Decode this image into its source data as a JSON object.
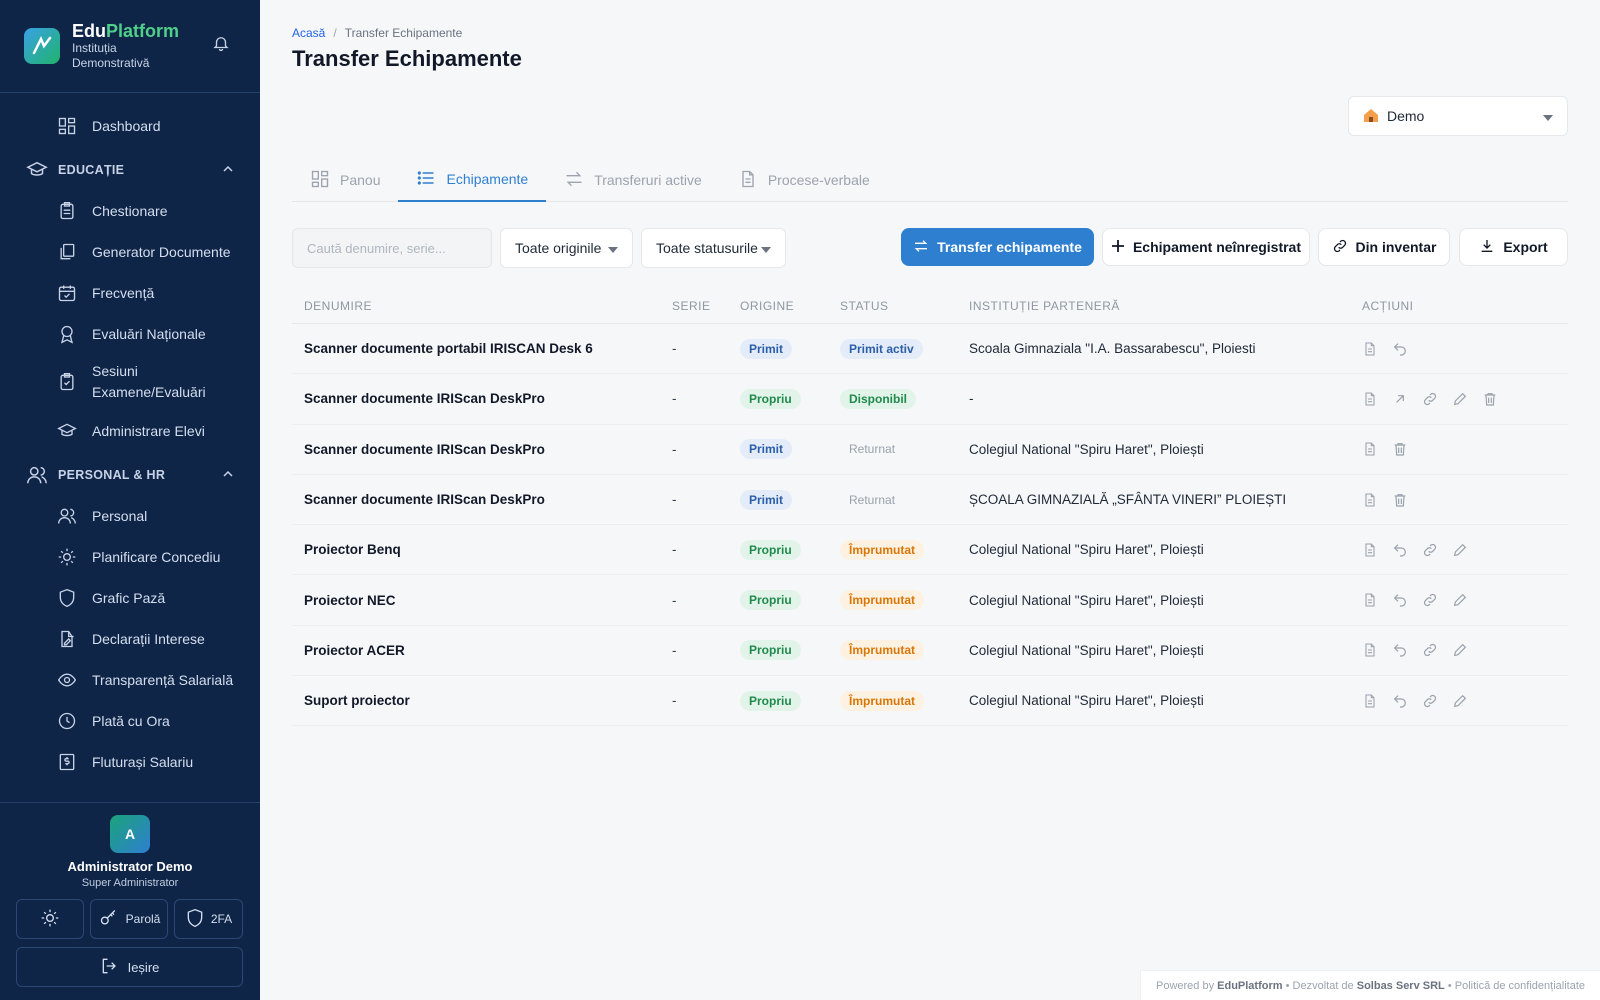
{
  "brand": {
    "name_a": "Edu",
    "name_b": "Platform",
    "subtitle": "Instituția Demonstrativă"
  },
  "nav": {
    "dashboard": "Dashboard",
    "section_education": "EDUCAȚIE",
    "chestionare": "Chestionare",
    "generator": "Generator Documente",
    "frecventa": "Frecvență",
    "evaluari": "Evaluări Naționale",
    "sesiuni_1": "Sesiuni",
    "sesiuni_2": "Examene/Evaluări",
    "elevi": "Administrare Elevi",
    "section_hr": "PERSONAL & HR",
    "personal": "Personal",
    "concediu": "Planificare Concediu",
    "paza": "Grafic Pază",
    "declaratii": "Declarații Interese",
    "transparenta": "Transparență Salarială",
    "plata": "Plată cu Ora",
    "fluturasi": "Fluturași Salariu"
  },
  "user": {
    "initial": "A",
    "name": "Administrator Demo",
    "role": "Super Administrator",
    "password_label": "Parolă",
    "twofa_label": "2FA",
    "logout_label": "Ieșire"
  },
  "breadcrumb": {
    "home": "Acasă",
    "sep": "/",
    "current": "Transfer Echipamente"
  },
  "page": {
    "title": "Transfer Echipamente"
  },
  "institution": {
    "selected": "Demo"
  },
  "tabs": {
    "panou": "Panou",
    "echipamente": "Echipamente",
    "transferuri": "Transferuri active",
    "procese": "Procese-verbale"
  },
  "toolbar": {
    "search_placeholder": "Caută denumire, serie...",
    "origin_filter": "Toate originile",
    "status_filter": "Toate statusurile",
    "transfer_btn": "Transfer echipamente",
    "unregistered_btn": "Echipament neînregistrat",
    "inventory_btn": "Din inventar",
    "export_btn": "Export"
  },
  "table": {
    "headers": {
      "name": "DENUMIRE",
      "serial": "SERIE",
      "origin": "ORIGINE",
      "status": "STATUS",
      "partner": "INSTITUȚIE PARTENERĂ",
      "actions": "ACȚIUNI"
    },
    "rows": [
      {
        "name": "Scanner documente portabil IRISCAN Desk 6",
        "serial": "-",
        "origin": "Primit",
        "status": "Primit activ",
        "partner": "Scoala Gimnaziala \"I.A. Bassarabescu\", Ploiesti"
      },
      {
        "name": "Scanner documente IRIScan DeskPro",
        "serial": "-",
        "origin": "Propriu",
        "status": "Disponibil",
        "partner": "-"
      },
      {
        "name": "Scanner documente IRIScan DeskPro",
        "serial": "-",
        "origin": "Primit",
        "status": "Returnat",
        "partner": "Colegiul National \"Spiru Haret\", Ploiești"
      },
      {
        "name": "Scanner documente IRIScan DeskPro",
        "serial": "-",
        "origin": "Primit",
        "status": "Returnat",
        "partner": "ȘCOALA GIMNAZIALĂ „SFÂNTA VINERI” PLOIEȘTI"
      },
      {
        "name": "Proiector Benq",
        "serial": "-",
        "origin": "Propriu",
        "status": "Împrumutat",
        "partner": "Colegiul National \"Spiru Haret\", Ploiești"
      },
      {
        "name": "Proiector NEC",
        "serial": "-",
        "origin": "Propriu",
        "status": "Împrumutat",
        "partner": "Colegiul National \"Spiru Haret\", Ploiești"
      },
      {
        "name": "Proiector ACER",
        "serial": "-",
        "origin": "Propriu",
        "status": "Împrumutat",
        "partner": "Colegiul National \"Spiru Haret\", Ploiești"
      },
      {
        "name": "Suport proiector",
        "serial": "-",
        "origin": "Propriu",
        "status": "Împrumutat",
        "partner": "Colegiul National \"Spiru Haret\", Ploiești"
      }
    ]
  },
  "footer": {
    "powered": "Powered by",
    "brand": "EduPlatform",
    "dev": "• Dezvoltat de",
    "company": "Solbas Serv SRL",
    "privacy": "• Politică de confidențialitate"
  },
  "colors": {
    "sidebar": "#0f2548",
    "primary": "#2f7fd1",
    "accent_green": "#4fd08a"
  }
}
